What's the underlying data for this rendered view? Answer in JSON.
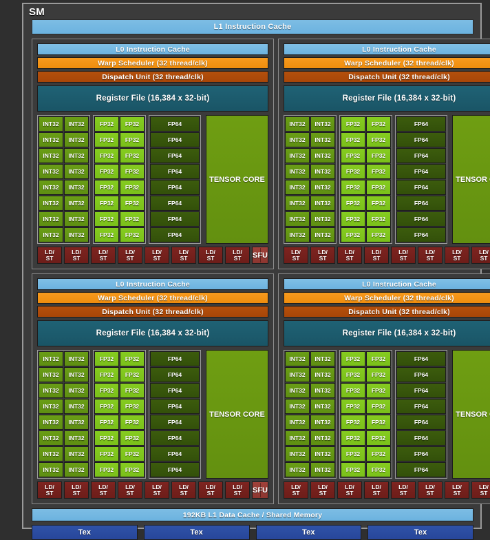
{
  "diagram": {
    "title": "SM",
    "l1_instruction_cache": "L1 Instruction Cache",
    "l1_data_cache": "192KB L1 Data Cache / Shared Memory",
    "tex_blocks": [
      "Tex",
      "Tex",
      "Tex",
      "Tex"
    ],
    "quadrant_count": 4,
    "quadrant": {
      "l0_instruction_cache": "L0 Instruction Cache",
      "warp_scheduler": "Warp Scheduler (32 thread/clk)",
      "dispatch_unit": "Dispatch Unit (32 thread/clk)",
      "register_file": "Register File (16,384 x 32-bit)",
      "tensor_core": "TENSOR CORE",
      "sfu": "SFU",
      "ldst": "LD/ST",
      "ldst_count": 8,
      "core_rows": 8,
      "int32_label": "INT32",
      "int32_columns": 2,
      "fp32_label": "FP32",
      "fp32_columns": 2,
      "fp64_label": "FP64",
      "fp64_columns": 1
    },
    "colors": {
      "background": "#2f2f2f",
      "frame": "#3b3b3b",
      "cache_blue": "#6bb2df",
      "warp_orange": "#ef8d0d",
      "dispatch_brown": "#a84608",
      "register_teal": "#1a5566",
      "int32_green": "#5e8e12",
      "fp32_green": "#7ac01a",
      "fp64_green": "#33500a",
      "tensor_green": "#639010",
      "ldst_red": "#6d1d19",
      "sfu_red": "#8d3630",
      "tex_blue": "#27469a"
    }
  }
}
